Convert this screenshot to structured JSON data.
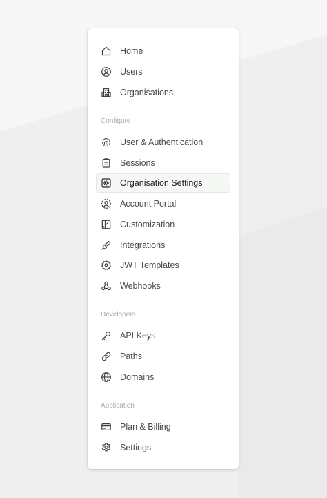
{
  "nav": {
    "items": [
      {
        "label": "Home",
        "icon": "home-icon"
      },
      {
        "label": "Users",
        "icon": "user-circle-icon"
      },
      {
        "label": "Organisations",
        "icon": "building-icon"
      }
    ]
  },
  "configure": {
    "title": "Configure",
    "items": [
      {
        "label": "User & Authentication",
        "icon": "fingerprint-icon"
      },
      {
        "label": "Sessions",
        "icon": "clipboard-icon"
      },
      {
        "label": "Organisation Settings",
        "icon": "gear-square-icon",
        "active": true
      },
      {
        "label": "Account Portal",
        "icon": "user-dashed-circle-icon"
      },
      {
        "label": "Customization",
        "icon": "palette-icon"
      },
      {
        "label": "Integrations",
        "icon": "plug-icon"
      },
      {
        "label": "JWT Templates",
        "icon": "badge-icon"
      },
      {
        "label": "Webhooks",
        "icon": "webhook-icon"
      }
    ]
  },
  "developers": {
    "title": "Developers",
    "items": [
      {
        "label": "API Keys",
        "icon": "key-icon"
      },
      {
        "label": "Paths",
        "icon": "link-icon"
      },
      {
        "label": "Domains",
        "icon": "globe-icon"
      }
    ]
  },
  "application": {
    "title": "Application",
    "items": [
      {
        "label": "Plan & Billing",
        "icon": "credit-card-icon"
      },
      {
        "label": "Settings",
        "icon": "gear-icon"
      }
    ]
  },
  "colors": {
    "background": "#f0f0f0",
    "panel": "#ffffff",
    "active_item_bg": "#f6f8f6",
    "text": "#4a4a4a",
    "section_text": "#a9a9a9"
  }
}
